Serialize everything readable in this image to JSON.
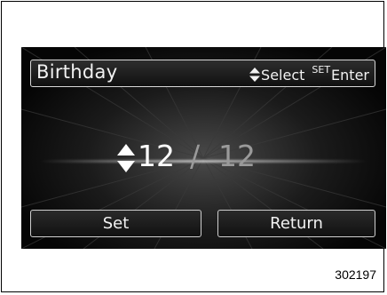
{
  "title": "Birthday",
  "hint": {
    "select_label": "Select",
    "set_label": "SET",
    "enter_label": "Enter"
  },
  "date": {
    "month": "12",
    "separator": "/",
    "day": "12"
  },
  "buttons": {
    "set_label": "Set",
    "return_label": "Return"
  },
  "figure_id": "302197",
  "colors": {
    "screen_bg": "#050505",
    "text": "#f2f2f2",
    "dim_text": "#9a9a9a",
    "border": "#d8d8d8"
  },
  "icons": {
    "select_arrows": "up-down-arrows-icon",
    "value_arrows": "up-down-arrows-icon"
  }
}
